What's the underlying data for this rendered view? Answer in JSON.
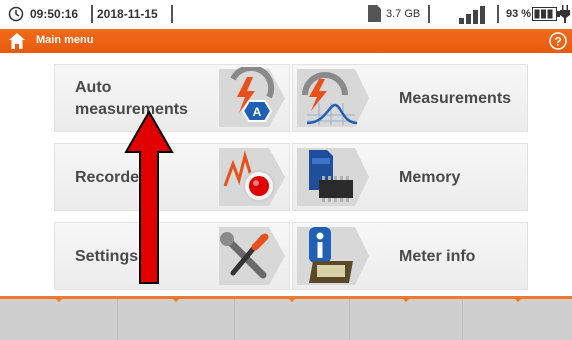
{
  "status_bar": {
    "time": "09:50:16",
    "date": "2018-11-15",
    "storage": "3.7 GB",
    "battery": "93 %",
    "icons": [
      "clock-icon",
      "sd-card-icon",
      "signal-bars-icon",
      "battery-icon",
      "plug-icon"
    ]
  },
  "title_bar": {
    "title": "Main menu",
    "icons": [
      "home-icon",
      "help-icon"
    ]
  },
  "menu": {
    "auto_measurements": "Auto measurements",
    "auto_line1": "Auto",
    "auto_line2": "measurements",
    "measurements": "Measurements",
    "recorder": "Recorder",
    "memory": "Memory",
    "settings": "Settings",
    "meter_info": "Meter info"
  },
  "colors": {
    "accent_orange": "#e85a0c",
    "tile_bg": "#f0f0f0",
    "label_text": "#4a4a4a",
    "arrow_red": "#e00000",
    "bottom_bar": "#cfcfcf"
  },
  "bottom_bar": {
    "slot_count": 5
  }
}
